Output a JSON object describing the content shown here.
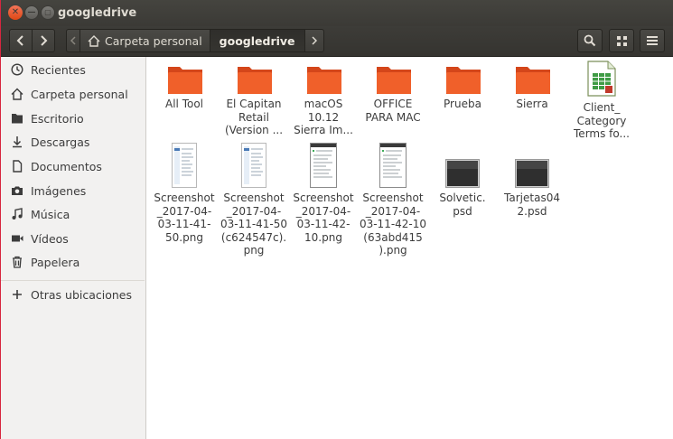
{
  "window": {
    "title": "googledrive"
  },
  "toolbar": {
    "path": [
      {
        "label": "Carpeta personal",
        "icon": "home-icon"
      },
      {
        "label": "googledrive",
        "active": true
      }
    ]
  },
  "sidebar": {
    "items": [
      {
        "label": "Recientes",
        "icon": "clock-icon"
      },
      {
        "label": "Carpeta personal",
        "icon": "home-icon"
      },
      {
        "label": "Escritorio",
        "icon": "desktop-folder-icon"
      },
      {
        "label": "Descargas",
        "icon": "download-icon"
      },
      {
        "label": "Documentos",
        "icon": "document-icon"
      },
      {
        "label": "Imágenes",
        "icon": "camera-icon"
      },
      {
        "label": "Música",
        "icon": "music-icon"
      },
      {
        "label": "Vídeos",
        "icon": "video-icon"
      },
      {
        "label": "Papelera",
        "icon": "trash-icon"
      }
    ],
    "other": {
      "label": "Otras ubicaciones",
      "icon": "plus-icon"
    }
  },
  "files": [
    {
      "name": "All Tool",
      "kind": "folder"
    },
    {
      "name": "El Capitan\nRetail\n(Version ...",
      "kind": "folder"
    },
    {
      "name": "macOS\n10.12\nSierra Im...",
      "kind": "folder"
    },
    {
      "name": "OFFICE\nPARA MAC",
      "kind": "folder"
    },
    {
      "name": "Prueba",
      "kind": "folder"
    },
    {
      "name": "Sierra",
      "kind": "folder"
    },
    {
      "name": "Client_\nCategory\nTerms fo...",
      "kind": "spreadsheet"
    },
    {
      "name": "Screenshot\n_2017-04-\n03-11-41-\n50.png",
      "kind": "png"
    },
    {
      "name": "Screenshot\n_2017-04-\n03-11-41-50\n(c624547c).\npng",
      "kind": "png"
    },
    {
      "name": "Screenshot\n_2017-04-\n03-11-42-\n10.png",
      "kind": "png"
    },
    {
      "name": "Screenshot\n_2017-04-\n03-11-42-10\n(63abd415\n).png",
      "kind": "png"
    },
    {
      "name": "Solvetic.\npsd",
      "kind": "psd"
    },
    {
      "name": "Tarjetas04\n2.psd",
      "kind": "psd"
    }
  ],
  "colors": {
    "folder": "#f0602a",
    "titlebar": "#3b3a36",
    "accent": "#e95420"
  }
}
